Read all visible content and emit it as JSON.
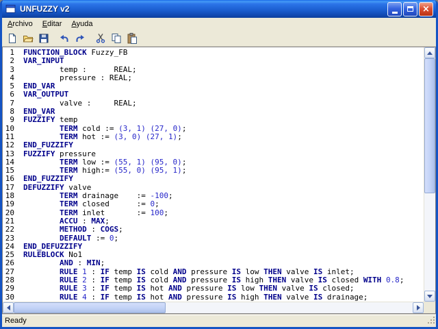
{
  "window": {
    "title": "UNFUZZY v2"
  },
  "titlebar": {
    "buttons": [
      "minimize",
      "maximize",
      "close"
    ]
  },
  "menu": {
    "items": [
      "Archivo",
      "Editar",
      "Ayuda"
    ]
  },
  "toolbar": {
    "buttons": [
      "new-document-icon",
      "open-folder-icon",
      "save-icon",
      "undo-icon",
      "redo-icon",
      "cut-icon",
      "copy-icon",
      "paste-icon"
    ]
  },
  "colors": {
    "titlebar_blue": "#1a5ccd",
    "close_red": "#dd5133",
    "keyword_navy": "#00008b",
    "number_blue": "#2626c9",
    "menubar_bg": "#ece9d8"
  },
  "editor": {
    "lines": [
      {
        "n": 1,
        "s": [
          [
            "k",
            "FUNCTION_BLOCK"
          ],
          [
            "p",
            " Fuzzy_FB"
          ]
        ]
      },
      {
        "n": 2,
        "s": [
          [
            "k",
            "VAR_INPUT"
          ]
        ]
      },
      {
        "n": 3,
        "s": [
          [
            "p",
            "        temp :      REAL;"
          ]
        ]
      },
      {
        "n": 4,
        "s": [
          [
            "p",
            "        pressure : REAL;"
          ]
        ]
      },
      {
        "n": 5,
        "s": [
          [
            "k",
            "END_VAR"
          ]
        ]
      },
      {
        "n": 6,
        "s": [
          [
            "k",
            "VAR_OUTPUT"
          ]
        ]
      },
      {
        "n": 7,
        "s": [
          [
            "p",
            "        valve :     REAL;"
          ]
        ]
      },
      {
        "n": 8,
        "s": [
          [
            "k",
            "END_VAR"
          ]
        ]
      },
      {
        "n": 9,
        "s": [
          [
            "k",
            "FUZZIFY"
          ],
          [
            "p",
            " temp"
          ]
        ]
      },
      {
        "n": 10,
        "s": [
          [
            "p",
            "        "
          ],
          [
            "k",
            "TERM"
          ],
          [
            "p",
            " cold := "
          ],
          [
            "n",
            "(3, 1) (27, 0)"
          ],
          [
            "p",
            ";"
          ]
        ]
      },
      {
        "n": 11,
        "s": [
          [
            "p",
            "        "
          ],
          [
            "k",
            "TERM"
          ],
          [
            "p",
            " hot := "
          ],
          [
            "n",
            "(3, 0) (27, 1)"
          ],
          [
            "p",
            ";"
          ]
        ]
      },
      {
        "n": 12,
        "s": [
          [
            "k",
            "END_FUZZIFY"
          ]
        ]
      },
      {
        "n": 13,
        "s": [
          [
            "k",
            "FUZZIFY"
          ],
          [
            "p",
            " pressure"
          ]
        ]
      },
      {
        "n": 14,
        "s": [
          [
            "p",
            "        "
          ],
          [
            "k",
            "TERM"
          ],
          [
            "p",
            " low := "
          ],
          [
            "n",
            "(55, 1) (95, 0)"
          ],
          [
            "p",
            ";"
          ]
        ]
      },
      {
        "n": 15,
        "s": [
          [
            "p",
            "        "
          ],
          [
            "k",
            "TERM"
          ],
          [
            "p",
            " high:= "
          ],
          [
            "n",
            "(55, 0) (95, 1)"
          ],
          [
            "p",
            ";"
          ]
        ]
      },
      {
        "n": 16,
        "s": [
          [
            "k",
            "END_FUZZIFY"
          ]
        ]
      },
      {
        "n": 17,
        "s": [
          [
            "k",
            "DEFUZZIFY"
          ],
          [
            "p",
            " valve"
          ]
        ]
      },
      {
        "n": 18,
        "s": [
          [
            "p",
            "        "
          ],
          [
            "k",
            "TERM"
          ],
          [
            "p",
            " drainage    := "
          ],
          [
            "n",
            "-100"
          ],
          [
            "p",
            ";"
          ]
        ]
      },
      {
        "n": 19,
        "s": [
          [
            "p",
            "        "
          ],
          [
            "k",
            "TERM"
          ],
          [
            "p",
            " closed      := "
          ],
          [
            "n",
            "0"
          ],
          [
            "p",
            ";"
          ]
        ]
      },
      {
        "n": 20,
        "s": [
          [
            "p",
            "        "
          ],
          [
            "k",
            "TERM"
          ],
          [
            "p",
            " inlet       := "
          ],
          [
            "n",
            "100"
          ],
          [
            "p",
            ";"
          ]
        ]
      },
      {
        "n": 21,
        "s": [
          [
            "p",
            "        "
          ],
          [
            "k",
            "ACCU"
          ],
          [
            "p",
            " : "
          ],
          [
            "k",
            "MAX"
          ],
          [
            "p",
            ";"
          ]
        ]
      },
      {
        "n": 22,
        "s": [
          [
            "p",
            "        "
          ],
          [
            "k",
            "METHOD"
          ],
          [
            "p",
            " : "
          ],
          [
            "k",
            "COGS"
          ],
          [
            "p",
            ";"
          ]
        ]
      },
      {
        "n": 23,
        "s": [
          [
            "p",
            "        "
          ],
          [
            "k",
            "DEFAULT"
          ],
          [
            "p",
            " := "
          ],
          [
            "n",
            "0"
          ],
          [
            "p",
            ";"
          ]
        ]
      },
      {
        "n": 24,
        "s": [
          [
            "k",
            "END_DEFUZZIFY"
          ]
        ]
      },
      {
        "n": 25,
        "s": [
          [
            "k",
            "RULEBLOCK"
          ],
          [
            "p",
            " No1"
          ]
        ]
      },
      {
        "n": 26,
        "s": [
          [
            "p",
            "        "
          ],
          [
            "k",
            "AND"
          ],
          [
            "p",
            " : "
          ],
          [
            "k",
            "MIN"
          ],
          [
            "p",
            ";"
          ]
        ]
      },
      {
        "n": 27,
        "s": [
          [
            "p",
            "        "
          ],
          [
            "k",
            "RULE"
          ],
          [
            "p",
            " "
          ],
          [
            "n",
            "1"
          ],
          [
            "p",
            " : "
          ],
          [
            "k",
            "IF"
          ],
          [
            "p",
            " temp "
          ],
          [
            "k",
            "IS"
          ],
          [
            "p",
            " cold "
          ],
          [
            "k",
            "AND"
          ],
          [
            "p",
            " pressure "
          ],
          [
            "k",
            "IS"
          ],
          [
            "p",
            " low "
          ],
          [
            "k",
            "THEN"
          ],
          [
            "p",
            " valve "
          ],
          [
            "k",
            "IS"
          ],
          [
            "p",
            " inlet;"
          ]
        ]
      },
      {
        "n": 28,
        "s": [
          [
            "p",
            "        "
          ],
          [
            "k",
            "RULE"
          ],
          [
            "p",
            " "
          ],
          [
            "n",
            "2"
          ],
          [
            "p",
            " : "
          ],
          [
            "k",
            "IF"
          ],
          [
            "p",
            " temp "
          ],
          [
            "k",
            "IS"
          ],
          [
            "p",
            " cold "
          ],
          [
            "k",
            "AND"
          ],
          [
            "p",
            " pressure "
          ],
          [
            "k",
            "IS"
          ],
          [
            "p",
            " high "
          ],
          [
            "k",
            "THEN"
          ],
          [
            "p",
            " valve "
          ],
          [
            "k",
            "IS"
          ],
          [
            "p",
            " closed "
          ],
          [
            "k",
            "WITH"
          ],
          [
            "p",
            " "
          ],
          [
            "n",
            "0.8"
          ],
          [
            "p",
            ";"
          ]
        ]
      },
      {
        "n": 29,
        "s": [
          [
            "p",
            "        "
          ],
          [
            "k",
            "RULE"
          ],
          [
            "p",
            " "
          ],
          [
            "n",
            "3"
          ],
          [
            "p",
            " : "
          ],
          [
            "k",
            "IF"
          ],
          [
            "p",
            " temp "
          ],
          [
            "k",
            "IS"
          ],
          [
            "p",
            " hot "
          ],
          [
            "k",
            "AND"
          ],
          [
            "p",
            " pressure "
          ],
          [
            "k",
            "IS"
          ],
          [
            "p",
            " low "
          ],
          [
            "k",
            "THEN"
          ],
          [
            "p",
            " valve "
          ],
          [
            "k",
            "IS"
          ],
          [
            "p",
            " closed;"
          ]
        ]
      },
      {
        "n": 30,
        "s": [
          [
            "p",
            "        "
          ],
          [
            "k",
            "RULE"
          ],
          [
            "p",
            " "
          ],
          [
            "n",
            "4"
          ],
          [
            "p",
            " : "
          ],
          [
            "k",
            "IF"
          ],
          [
            "p",
            " temp "
          ],
          [
            "k",
            "IS"
          ],
          [
            "p",
            " hot "
          ],
          [
            "k",
            "AND"
          ],
          [
            "p",
            " pressure "
          ],
          [
            "k",
            "IS"
          ],
          [
            "p",
            " high "
          ],
          [
            "k",
            "THEN"
          ],
          [
            "p",
            " valve "
          ],
          [
            "k",
            "IS"
          ],
          [
            "p",
            " drainage;"
          ]
        ]
      }
    ]
  },
  "statusbar": {
    "text": "Ready"
  }
}
